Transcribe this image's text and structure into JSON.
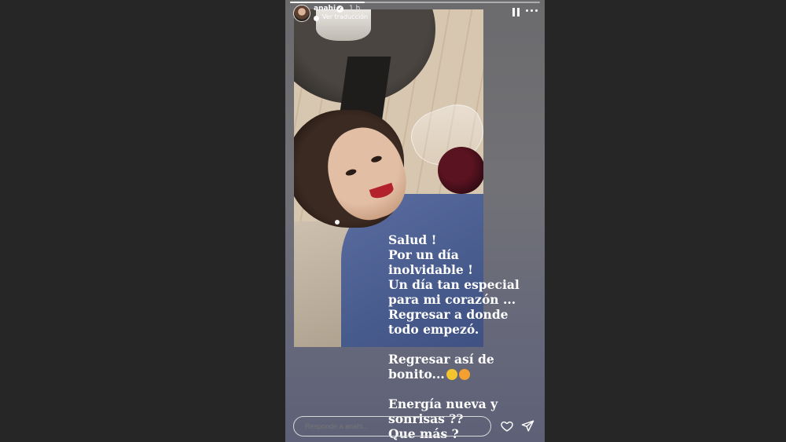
{
  "story": {
    "username": "anahi",
    "time": "1 h",
    "translate_label": "Ver traducción",
    "progress": 0.3
  },
  "caption": {
    "lines": [
      "Salud !",
      "Por un día",
      "inolvidable !",
      "Un día tan especial",
      "para mi corazón ...",
      "Regresar a donde",
      "todo empezó.",
      "",
      "Regresar así de",
      "bonito...",
      "",
      "Energía nueva y",
      "sonrisas ??",
      "Que más ?"
    ],
    "emojis": [
      "pleading-face-emoji",
      "heart-eyes-emoji"
    ]
  },
  "reply": {
    "placeholder": "Responde a anahi..."
  },
  "icons": {
    "pause": "pause-icon",
    "more": "more-icon",
    "heart": "heart-icon",
    "send": "send-icon"
  },
  "colors": {
    "background": "#262626",
    "emoji_yellow": "#f4c430"
  }
}
